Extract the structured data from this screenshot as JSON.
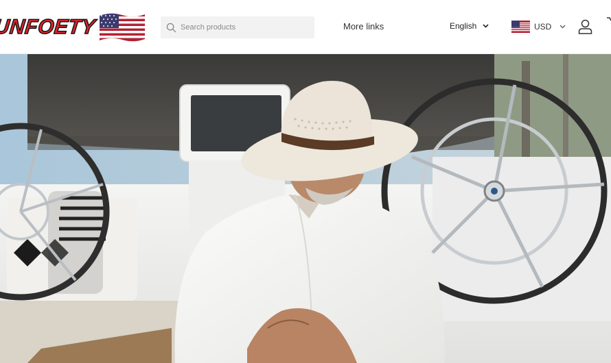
{
  "header": {
    "logo_text": "UNFOETY",
    "search": {
      "placeholder": "Search products",
      "value": ""
    },
    "more_links_label": "More links",
    "language": {
      "selected": "English"
    },
    "currency": {
      "selected": "USD",
      "flag_icon": "us-flag-icon"
    },
    "account_icon": "user-icon"
  },
  "hero": {
    "image": "man-in-white-hat-on-sailboat"
  },
  "colors": {
    "logo_red": "#e3232c",
    "logo_outline": "#141414",
    "search_bg": "#f2f2f2",
    "text": "#333333"
  }
}
